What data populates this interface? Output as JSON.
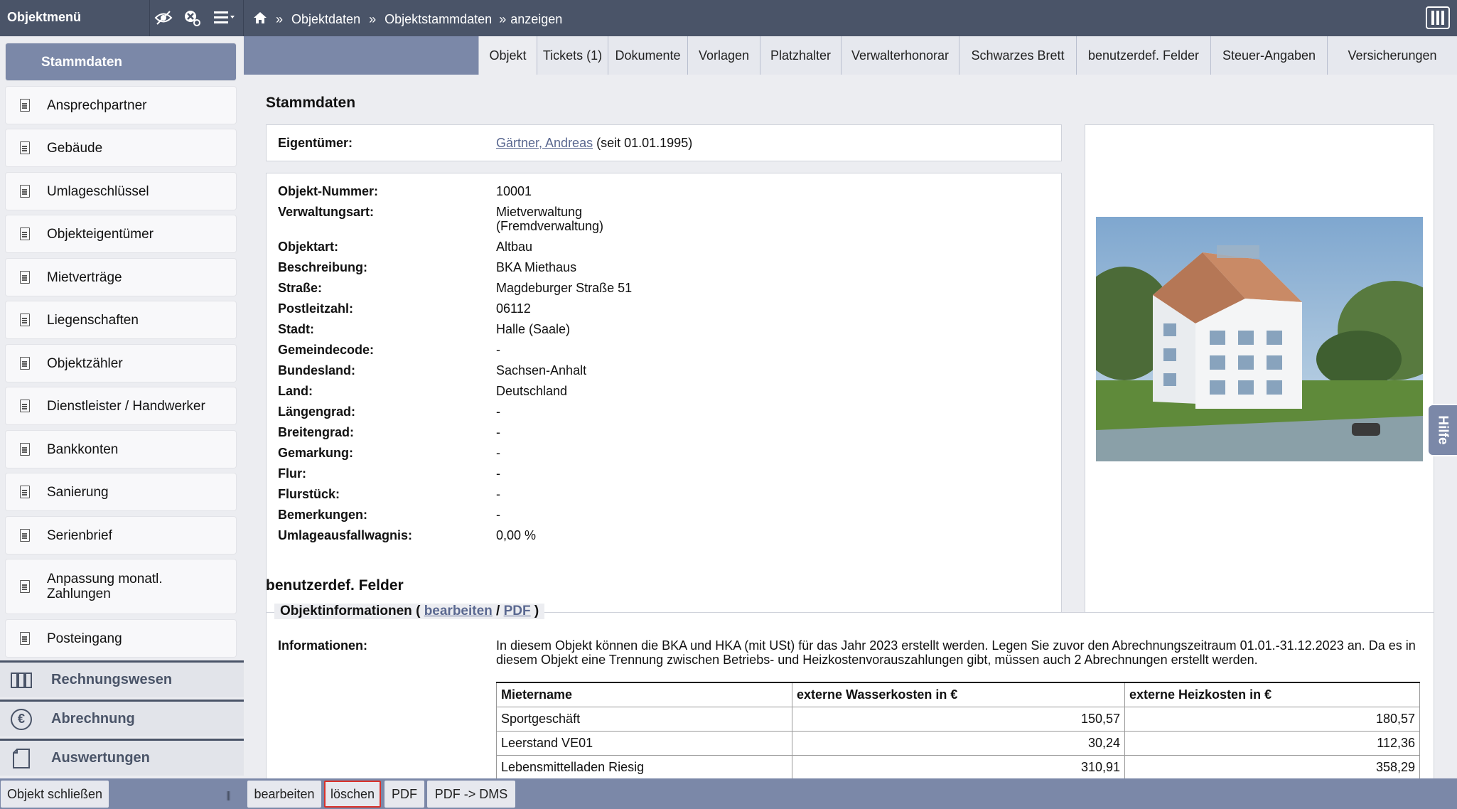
{
  "topbar": {
    "title": "Objektmenü",
    "breadcrumb": [
      "Objektdaten",
      "Objektstammdaten",
      "anzeigen"
    ],
    "sep": "»"
  },
  "sidebar": {
    "items": [
      {
        "label": "Stammdaten",
        "active": true
      },
      {
        "label": "Ansprechpartner"
      },
      {
        "label": "Gebäude"
      },
      {
        "label": "Umlageschlüssel"
      },
      {
        "label": "Objekteigentümer"
      },
      {
        "label": "Mietverträge"
      },
      {
        "label": "Liegenschaften"
      },
      {
        "label": "Objektzähler"
      },
      {
        "label": "Dienstleister / Handwerker"
      },
      {
        "label": "Bankkonten"
      },
      {
        "label": "Sanierung"
      },
      {
        "label": "Serienbrief"
      },
      {
        "label": "Anpassung monatl. Zahlungen"
      },
      {
        "label": "Posteingang"
      }
    ],
    "sections": [
      "Rechnungswesen",
      "Abrechnung",
      "Auswertungen"
    ],
    "euro_symbol": "€"
  },
  "tabs": [
    "Objekt",
    "Tickets (1)",
    "Dokumente",
    "Vorlagen",
    "Platzhalter",
    "Verwalterhonorar",
    "Schwarzes Brett",
    "benutzerdef. Felder",
    "Steuer-Angaben",
    "Versicherungen"
  ],
  "stammdaten": {
    "title": "Stammdaten",
    "owner_label": "Eigentümer:",
    "owner_name": "Gärtner, Andreas",
    "owner_since": "(seit 01.01.1995)",
    "fields": [
      {
        "k": "Objekt-Nummer:",
        "v": "10001"
      },
      {
        "k": "Verwaltungsart:",
        "v": "Mietverwaltung (Fremdverwaltung)"
      },
      {
        "k": "Objektart:",
        "v": "Altbau"
      },
      {
        "k": "Beschreibung:",
        "v": "BKA Miethaus"
      },
      {
        "k": "Straße:",
        "v": "Magdeburger Straße 51"
      },
      {
        "k": "Postleitzahl:",
        "v": "06112"
      },
      {
        "k": "Stadt:",
        "v": "Halle (Saale)"
      },
      {
        "k": "Gemeindecode:",
        "v": "-"
      },
      {
        "k": "Bundesland:",
        "v": "Sachsen-Anhalt"
      },
      {
        "k": "Land:",
        "v": "Deutschland"
      },
      {
        "k": "Längengrad:",
        "v": "-"
      },
      {
        "k": "Breitengrad:",
        "v": "-"
      },
      {
        "k": "Gemarkung:",
        "v": "-"
      },
      {
        "k": "Flur:",
        "v": "-"
      },
      {
        "k": "Flurstück:",
        "v": "-"
      },
      {
        "k": "Bemerkungen:",
        "v": "-"
      },
      {
        "k": "Umlageausfallwagnis:",
        "v": "0,00 %"
      }
    ]
  },
  "custom": {
    "title": "benutzerdef. Felder",
    "legend": "Objektinformationen",
    "edit_link": "bearbeiten",
    "pdf_link": "PDF",
    "info_label": "Informationen:",
    "info_text": "In diesem Objekt können die BKA und HKA (mit USt) für das Jahr 2023 erstellt werden. Legen Sie zuvor den Abrechnungszeitraum 01.01.-31.12.2023 an. Da es in diesem Objekt eine Trennung zwischen Betriebs- und Heizkostenvorauszahlungen gibt, müssen auch 2 Abrechnungen erstellt werden.",
    "table": {
      "headers": [
        "Mietername",
        "externe Wasserkosten in €",
        "externe Heizkosten in €"
      ],
      "rows": [
        [
          "Sportgeschäft",
          "150,57",
          "180,57"
        ],
        [
          "Leerstand VE01",
          "30,24",
          "112,36"
        ],
        [
          "Lebensmittelladen Riesig",
          "310,91",
          "358,29"
        ]
      ]
    }
  },
  "help": "Hilfe",
  "bottombar": {
    "close": "Objekt schließen",
    "buttons": [
      "bearbeiten",
      "löschen",
      "PDF",
      "PDF -> DMS"
    ]
  }
}
